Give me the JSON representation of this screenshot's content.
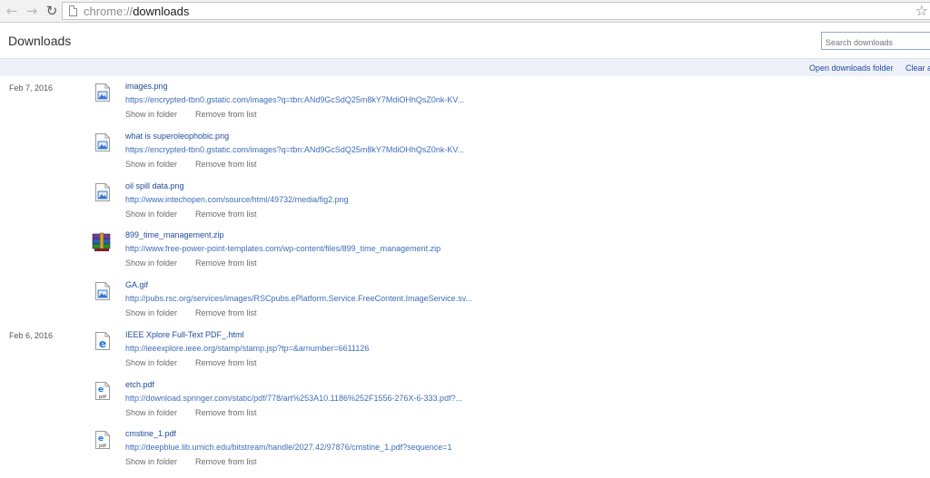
{
  "browser": {
    "url_scheme": "chrome://",
    "url_host": "downloads",
    "back_icon": "arrow-left-icon",
    "forward_icon": "arrow-right-icon",
    "reload_icon": "reload-icon",
    "star_icon": "star-icon"
  },
  "header": {
    "title": "Downloads",
    "search_placeholder": "Search downloads"
  },
  "actions": {
    "open_folder": "Open downloads folder",
    "clear_all": "Clear a"
  },
  "item_actions": {
    "show_in_folder": "Show in folder",
    "remove_from_list": "Remove from list"
  },
  "groups": [
    {
      "date": "Feb 7, 2016",
      "items": [
        {
          "name": "images.png",
          "url": "https://encrypted-tbn0.gstatic.com/images?q=tbn:ANd9GcSdQ25m8kY7MdiOHhQsZ0nk-KV...",
          "icon": "image-file-icon"
        },
        {
          "name": "what is superoleophobic.png",
          "url": "https://encrypted-tbn0.gstatic.com/images?q=tbn:ANd9GcSdQ25m8kY7MdiOHhQsZ0nk-KV...",
          "icon": "image-file-icon"
        },
        {
          "name": "oil spill data.png",
          "url": "http://www.intechopen.com/source/html/49732/media/fig2.png",
          "icon": "image-file-icon"
        },
        {
          "name": "899_time_management.zip",
          "url": "http://www.free-power-point-templates.com/wp-content/files/899_time_management.zip",
          "icon": "winrar-archive-icon"
        },
        {
          "name": "GA.gif",
          "url": "http://pubs.rsc.org/services/images/RSCpubs.ePlatform.Service.FreeContent.ImageService.sv...",
          "icon": "image-file-icon"
        }
      ]
    },
    {
      "date": "Feb 6, 2016",
      "items": [
        {
          "name": "IEEE Xplore Full-Text PDF_.html",
          "url": "http://ieeexplore.ieee.org/stamp/stamp.jsp?tp=&arnumber=6611126",
          "icon": "ie-html-file-icon"
        },
        {
          "name": "etch.pdf",
          "url": "http://download.springer.com/static/pdf/778/art%253A10.1186%252F1556-276X-6-333.pdf?...",
          "icon": "pdf-file-icon"
        },
        {
          "name": "cmstine_1.pdf",
          "url": "http://deepblue.lib.umich.edu/bitstream/handle/2027.42/97876/cmstine_1.pdf?sequence=1",
          "icon": "pdf-file-icon"
        }
      ]
    }
  ],
  "colors": {
    "link": "#1f4a9c",
    "url": "#3e6db9",
    "action_bar": "#eef1f7"
  }
}
